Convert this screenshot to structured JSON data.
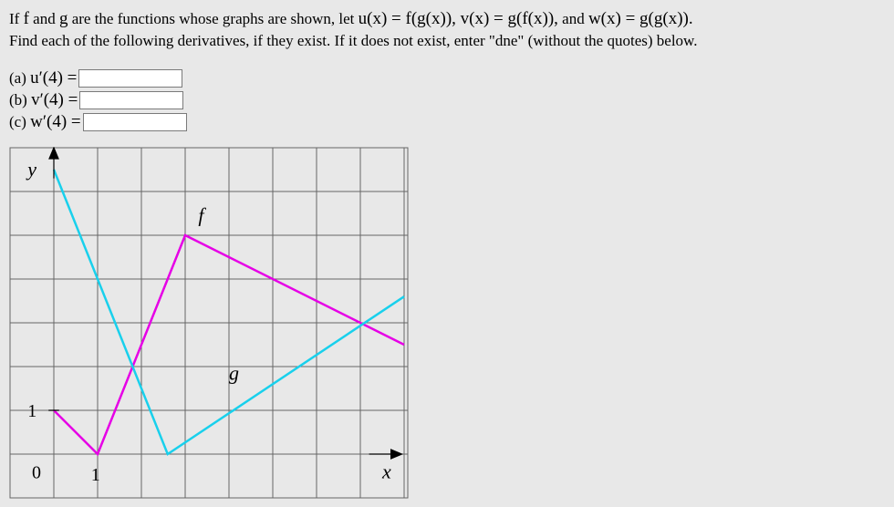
{
  "prompt": {
    "line1_pre": "If ",
    "f": "f",
    "line1_mid1": " and ",
    "g": "g",
    "line1_mid2": " are the functions whose graphs are shown, let ",
    "ux": "u(x) = f(g(x)), v(x) = g(f(x)),",
    "line1_mid3": " and ",
    "wx": "w(x) = g(g(x)).",
    "line2": "Find each of the following derivatives, if they exist. If it does not exist, enter \"dne\" (without the quotes) below."
  },
  "answers": {
    "a_label": "(a) ",
    "a_math": "u′(4) =",
    "b_label": "(b) ",
    "b_math": "v′(4) =",
    "c_label": "(c) ",
    "c_math": "w′(4) ="
  },
  "chart_data": {
    "type": "line",
    "xlabel": "x",
    "ylabel": "y",
    "x_range": [
      -1,
      8
    ],
    "y_range": [
      -1,
      7
    ],
    "x_ticks": [
      0,
      1
    ],
    "y_ticks": [
      1
    ],
    "origin_label": "0",
    "series": [
      {
        "name": "f",
        "label": "f",
        "color": "#e600e6",
        "points": [
          {
            "x": 0,
            "y": 1
          },
          {
            "x": 1,
            "y": 0
          },
          {
            "x": 3,
            "y": 5
          },
          {
            "x": 8,
            "y": 2.5
          }
        ]
      },
      {
        "name": "g",
        "label": "g",
        "color": "#19d0ec",
        "points": [
          {
            "x": 0,
            "y": 6.5
          },
          {
            "x": 2.6,
            "y": 0
          },
          {
            "x": 8,
            "y": 3.6
          }
        ]
      }
    ],
    "legend_positions": {
      "f": {
        "x": 3.3,
        "y": 5.3
      },
      "g": {
        "x": 4.0,
        "y": 1.7
      }
    }
  }
}
